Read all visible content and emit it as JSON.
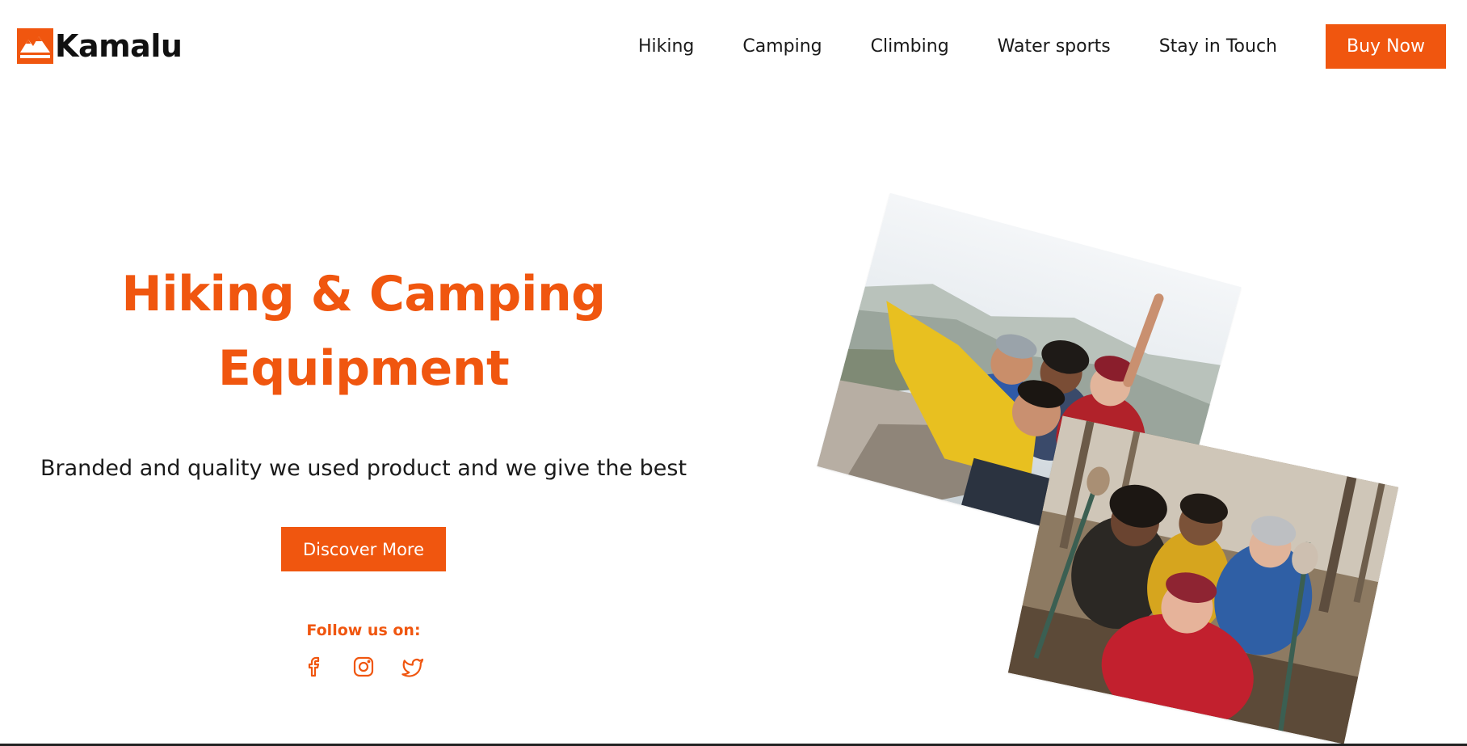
{
  "brand": {
    "name": "Kamalu",
    "logo_icon": "mountain-logo-icon",
    "accent_color": "#f0560f"
  },
  "nav": {
    "items": [
      {
        "label": "Hiking"
      },
      {
        "label": "Camping"
      },
      {
        "label": "Climbing"
      },
      {
        "label": "Water sports"
      },
      {
        "label": "Stay in Touch"
      }
    ],
    "cta_label": "Buy Now"
  },
  "hero": {
    "title_line1": "Hiking & Camping",
    "title_line2": "Equipment",
    "subtitle": "Branded and quality we used product and we give the best",
    "button_label": "Discover More",
    "follow_label": "Follow us on:",
    "socials": [
      {
        "icon": "facebook-icon"
      },
      {
        "icon": "instagram-icon"
      },
      {
        "icon": "twitter-icon"
      }
    ]
  },
  "images": [
    {
      "description_icon": "group-selfie-mountain-photo"
    },
    {
      "description_icon": "group-selfie-forest-photo"
    }
  ]
}
